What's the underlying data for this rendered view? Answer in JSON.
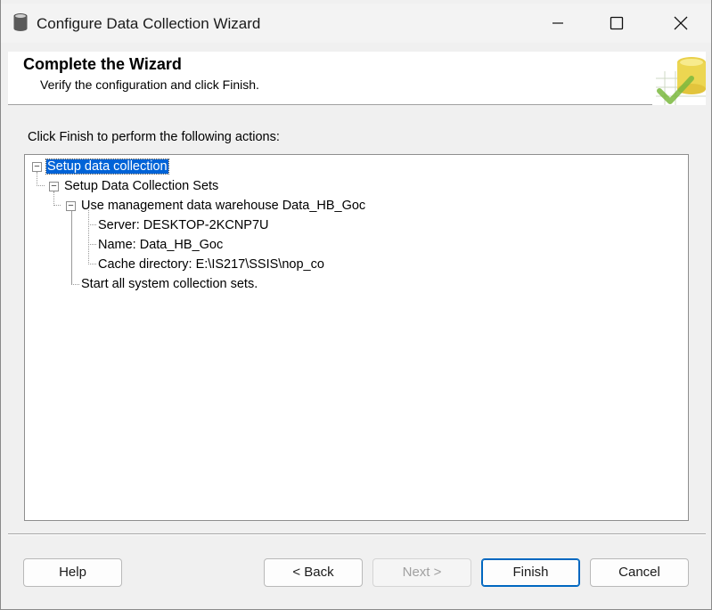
{
  "window": {
    "title": "Configure Data Collection Wizard"
  },
  "header": {
    "title": "Complete the Wizard",
    "subtitle": "Verify the configuration and click Finish."
  },
  "instruction": "Click Finish to perform the following actions:",
  "tree": {
    "root": "Setup data collection",
    "child": "Setup Data Collection Sets",
    "warehouse": "Use management data warehouse Data_HB_Goc",
    "server": "Server: DESKTOP-2KCNP7U",
    "name": "Name: Data_HB_Goc",
    "cache": "Cache directory: E:\\IS217\\SSIS\\nop_co",
    "start": "Start all system collection sets."
  },
  "buttons": {
    "help": "Help",
    "back": "< Back",
    "next": "Next >",
    "finish": "Finish",
    "cancel": "Cancel"
  },
  "icons": {
    "app": "database-icon",
    "header": "database-checkmark-icon",
    "minimize": "minimize-icon",
    "maximize": "maximize-icon",
    "close": "close-icon"
  }
}
